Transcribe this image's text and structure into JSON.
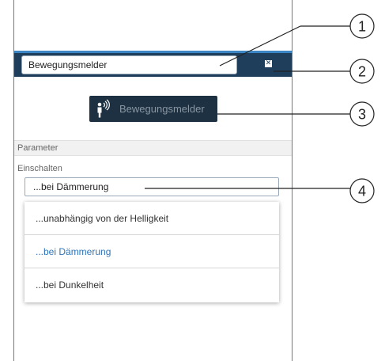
{
  "header": {
    "name_value": "Bewegungsmelder",
    "close_icon": "close-box-icon"
  },
  "device_button": {
    "label": "Bewegungsmelder",
    "icon": "motion-sensor-icon"
  },
  "section": {
    "title": "Parameter"
  },
  "field": {
    "label": "Einschalten",
    "selected_value": "...bei Dämmerung"
  },
  "dropdown": {
    "options": [
      "...unabhängig von der Helligkeit",
      "...bei Dämmerung",
      "...bei Dunkelheit"
    ],
    "selected_index": 1
  },
  "callouts": {
    "labels": [
      "1",
      "2",
      "3",
      "4"
    ]
  },
  "colors": {
    "accent": "#3d86c6",
    "header_bg": "#1f3e5c",
    "button_bg": "#1d3142",
    "selected_text": "#2f74b5"
  }
}
